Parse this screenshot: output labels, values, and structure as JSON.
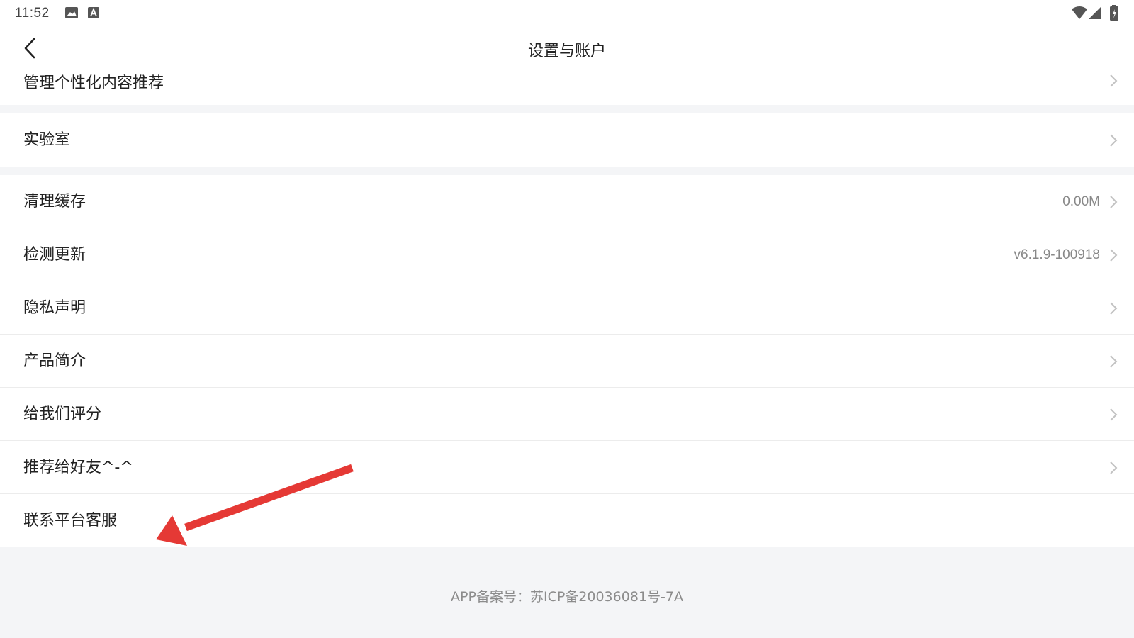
{
  "status_bar": {
    "time": "11:52",
    "icons": [
      "image-icon",
      "text-a-icon",
      "wifi-icon",
      "signal-icon",
      "battery-icon"
    ]
  },
  "header": {
    "title": "设置与账户",
    "back_icon": "chevron-left-icon"
  },
  "rows": [
    {
      "label": "管理个性化内容推荐",
      "value": "",
      "chevron": true
    },
    {
      "label": "实验室",
      "value": "",
      "chevron": true
    },
    {
      "label": "清理缓存",
      "value": "0.00M",
      "chevron": true
    },
    {
      "label": "检测更新",
      "value": "v6.1.9-100918",
      "chevron": true
    },
    {
      "label": "隐私声明",
      "value": "",
      "chevron": true
    },
    {
      "label": "产品简介",
      "value": "",
      "chevron": true
    },
    {
      "label": "给我们评分",
      "value": "",
      "chevron": true
    },
    {
      "label": "推荐给好友^-^",
      "value": "",
      "chevron": true
    },
    {
      "label": "联系平台客服",
      "value": "",
      "chevron": false
    }
  ],
  "footer": {
    "text": "APP备案号：苏ICP备20036081号-7A"
  },
  "colors": {
    "background": "#f4f5f7",
    "text": "#222222",
    "secondary_text": "#888888",
    "annotation_arrow": "#e53935"
  }
}
